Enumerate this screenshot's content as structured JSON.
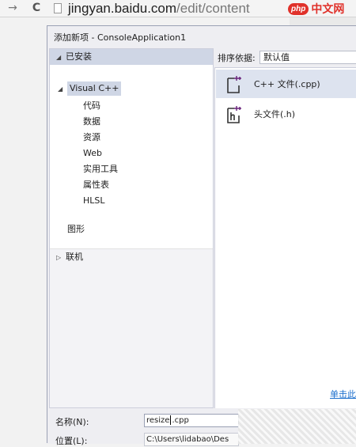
{
  "browser": {
    "url_domain": "jingyan.baidu.com",
    "url_path": "/edit/content",
    "back_glyph": "→",
    "reload_glyph": "C"
  },
  "watermark": {
    "badge": "php",
    "text": "中文网"
  },
  "dialog": {
    "title": "添加新项 - ConsoleApplication1",
    "installed": "已安装",
    "visual_cpp": "Visual C++",
    "children": [
      "代码",
      "数据",
      "资源",
      "Web",
      "实用工具",
      "属性表",
      "HLSL"
    ],
    "graphics": "图形",
    "online": "联机",
    "sort_label": "排序依据:",
    "sort_value": "默认值",
    "templates": [
      {
        "label": "C++ 文件(.cpp)",
        "icon": "cpp-file-icon"
      },
      {
        "label": "头文件(.h)",
        "icon": "header-file-icon"
      }
    ],
    "link_text": "单击此",
    "name_label": "名称(N):",
    "name_value_before": "resize",
    "name_value_after": ".cpp",
    "location_label": "位置(L):",
    "location_value": "C:\\Users\\lidabao\\Des"
  },
  "colors": {
    "accent": "#1e70cd",
    "selection": "#cfd6e5",
    "watermark": "#e0312a"
  }
}
